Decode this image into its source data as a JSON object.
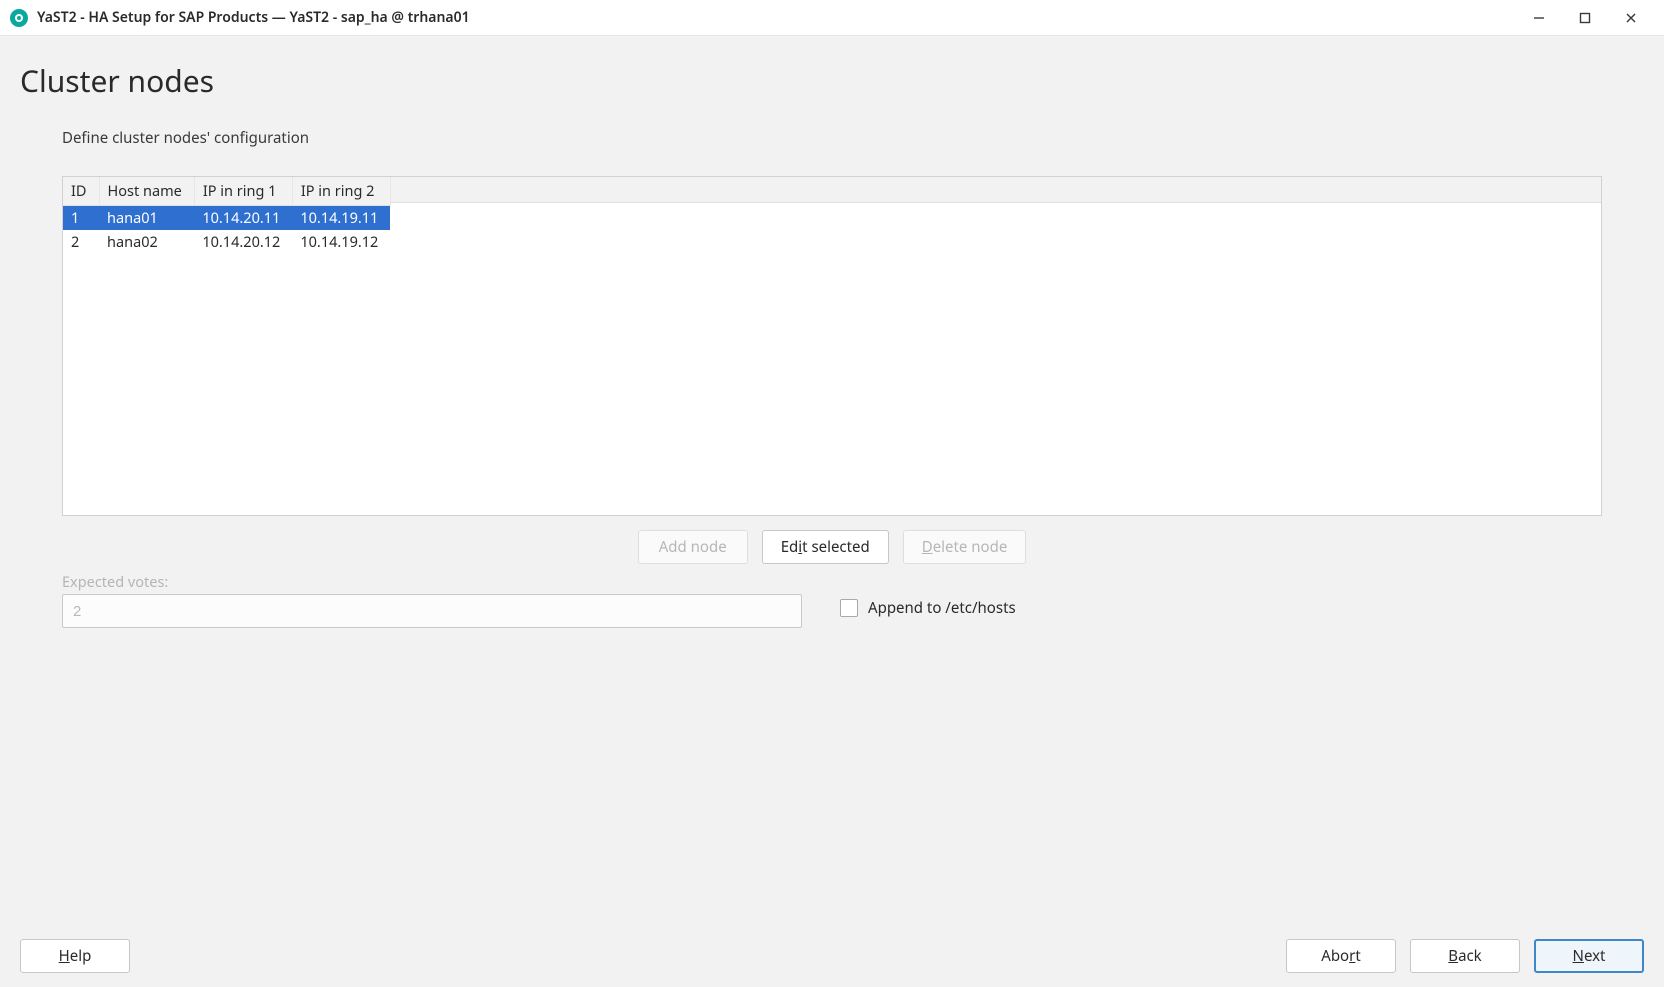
{
  "window": {
    "title": "YaST2 - HA Setup for SAP Products — YaST2 - sap_ha @ trhana01"
  },
  "page": {
    "title": "Cluster nodes",
    "subtitle": "Define cluster nodes' configuration"
  },
  "table": {
    "columns": {
      "id": "ID",
      "host": "Host name",
      "ring1": "IP in ring 1",
      "ring2": "IP in ring 2"
    },
    "rows": [
      {
        "id": "1",
        "host": "hana01",
        "ring1": "10.14.20.11",
        "ring2": "10.14.19.11",
        "selected": true
      },
      {
        "id": "2",
        "host": "hana02",
        "ring1": "10.14.20.12",
        "ring2": "10.14.19.12",
        "selected": false
      }
    ]
  },
  "buttons": {
    "add_node": "Add node",
    "edit_prefix": "Ed",
    "edit_mn": "i",
    "edit_suffix": "t selected",
    "delete_prefix": "",
    "delete_mn": "D",
    "delete_suffix": "elete node"
  },
  "expected": {
    "label": "Expected votes:",
    "value": "2"
  },
  "append": {
    "label_prefix": "A",
    "label_mn": "p",
    "label_suffix": "pend to /etc/hosts"
  },
  "footer": {
    "help_mn": "H",
    "help_suffix": "elp",
    "abort_prefix": "Abo",
    "abort_mn": "r",
    "abort_suffix": "t",
    "back_mn": "B",
    "back_suffix": "ack",
    "next_mn": "N",
    "next_suffix": "ext"
  }
}
